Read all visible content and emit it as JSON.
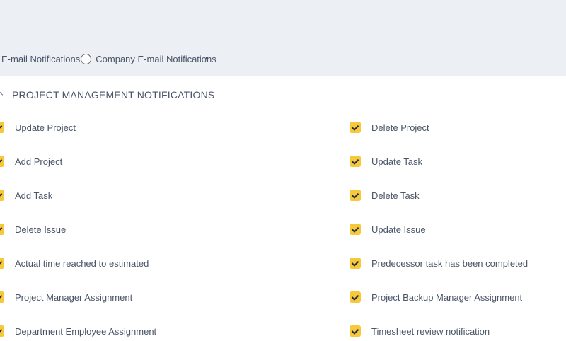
{
  "email_settings": {
    "personal_option": "E-mail Notifications",
    "company_option": "Company E-mail Notifications"
  },
  "section": {
    "title": "PROJECT MANAGEMENT NOTIFICATIONS",
    "left_items": [
      {
        "label": "Update Project",
        "checked": true
      },
      {
        "label": "Add Project",
        "checked": true
      },
      {
        "label": "Add Task",
        "checked": true
      },
      {
        "label": "Delete Issue",
        "checked": true
      },
      {
        "label": "Actual time reached to estimated",
        "checked": true
      },
      {
        "label": "Project Manager Assignment",
        "checked": true
      },
      {
        "label": "Department Employee Assignment",
        "checked": true
      }
    ],
    "right_items": [
      {
        "label": "Delete Project",
        "checked": true
      },
      {
        "label": "Update Task",
        "checked": true
      },
      {
        "label": "Delete Task",
        "checked": true
      },
      {
        "label": "Update Issue",
        "checked": true
      },
      {
        "label": "Predecessor task has been completed",
        "checked": true
      },
      {
        "label": "Project Backup Manager Assignment",
        "checked": true
      },
      {
        "label": "Timesheet review notification",
        "checked": true
      }
    ]
  },
  "colors": {
    "checkbox_fill": "#f6c83a",
    "top_band": "#eceff4",
    "text": "#4a5568"
  }
}
